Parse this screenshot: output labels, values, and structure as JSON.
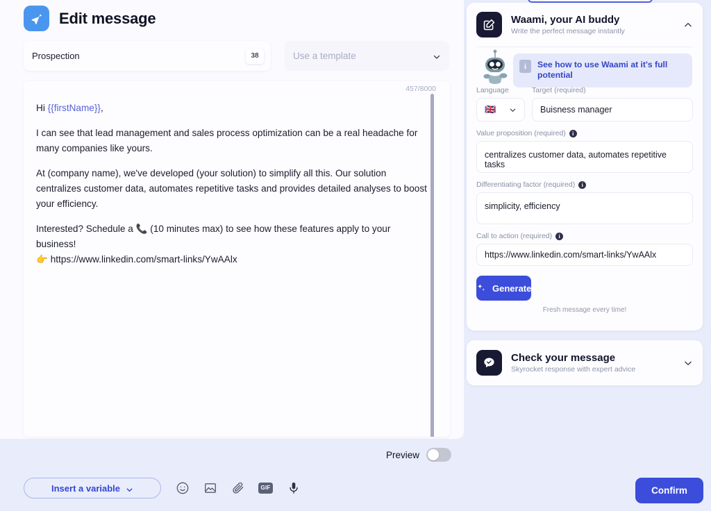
{
  "header": {
    "title": "Edit message",
    "logo_icon": "send-plane-icon",
    "accent_color": "#4a96ef"
  },
  "title_row": {
    "name_value": "Prospection",
    "char_badge": "38",
    "template_placeholder": "Use a template",
    "template_chevron_icon": "chevron-down-icon"
  },
  "message": {
    "char_counter": "457/8000",
    "greeting_prefix": "Hi ",
    "greeting_variable": "{{firstName}}",
    "greeting_suffix": ",",
    "paragraph_2": "I can see that lead management and sales process optimization can be a real headache for many companies like yours.",
    "paragraph_3": "At (company name), we've developed (your solution) to simplify all this. Our solution centralizes customer data, automates repetitive tasks and provides detailed analyses to boost your efficiency.",
    "paragraph_4": "Interested? Schedule a 📞 (10 minutes max) to see how these features apply to your business!",
    "link_line": "👉 https://www.linkedin.com/smart-links/YwAAlx"
  },
  "preview": {
    "label": "Preview",
    "enabled": false
  },
  "toolbar": {
    "insert_variable_label": "Insert a variable",
    "insert_variable_chevron_icon": "chevron-down-icon",
    "icons": [
      {
        "name": "emoji-icon",
        "glyph": "smiley"
      },
      {
        "name": "image-icon",
        "glyph": "picture"
      },
      {
        "name": "attachment-icon",
        "glyph": "paperclip"
      },
      {
        "name": "gif-icon",
        "glyph": "GIF"
      },
      {
        "name": "microphone-icon",
        "glyph": "mic"
      }
    ],
    "confirm_label": "Confirm",
    "confirm_color": "#3c4ddb"
  },
  "waami": {
    "icon": "edit-square-icon",
    "title": "Waami, your AI buddy",
    "subtitle": "Write the perfect message instantly",
    "collapse_icon": "chevron-up-icon",
    "mascot_icon": "robot-mascot-icon",
    "banner": {
      "info_glyph": "i",
      "text": "See how to use Waami at it's full potential"
    },
    "fields": {
      "language_label": "Language",
      "language_flag": "🇬🇧",
      "target_label": "Target (required)",
      "target_value": "Buisness manager",
      "value_prop_label": "Value proposition (required)",
      "value_prop_value": "centralizes customer data, automates repetitive tasks",
      "diff_label": "Differentiating factor (required)",
      "diff_value": "simplicity, efficiency",
      "cta_label": "Call to action (required)",
      "cta_value": "https://www.linkedin.com/smart-links/YwAAlx"
    },
    "generate_label": "Generate",
    "generate_icon": "sparkle-icon",
    "generate_note": "Fresh message every time!"
  },
  "check_message": {
    "icon": "chat-check-icon",
    "title": "Check your message",
    "subtitle": "Skyrocket response with expert advice",
    "expand_icon": "chevron-down-icon"
  }
}
